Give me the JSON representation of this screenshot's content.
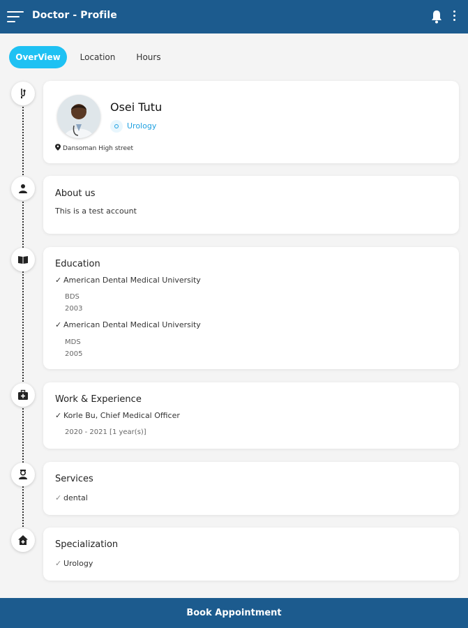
{
  "appbar": {
    "title": "Doctor - Profile",
    "menu_icon": "hamburger-menu-icon",
    "bell_icon": "bell-icon",
    "more_icon": "more-vertical-icon",
    "color": "#1c5b8e"
  },
  "tabs": [
    {
      "label": "OverView",
      "active": true
    },
    {
      "label": "Location",
      "active": false
    },
    {
      "label": "Hours",
      "active": false
    }
  ],
  "accent_color": "#1ec1f3",
  "profile": {
    "name": "Osei Tutu",
    "specialty": "Urology",
    "address": "Dansoman High street"
  },
  "about": {
    "title": "About us",
    "text": "This is a test account"
  },
  "education": {
    "title": "Education",
    "items": [
      {
        "school": "American Dental Medical University",
        "degree": "BDS",
        "year": "2003"
      },
      {
        "school": "American Dental Medical University",
        "degree": "MDS",
        "year": "2005"
      }
    ]
  },
  "work": {
    "title": "Work & Experience",
    "items": [
      {
        "role": "Korle Bu, Chief Medical Officer",
        "period": "2020 - 2021 [1 year(s)]"
      }
    ]
  },
  "services": {
    "title": "Services",
    "items": [
      "dental"
    ]
  },
  "specialization": {
    "title": "Specialization",
    "items": [
      "Urology"
    ]
  },
  "footer": {
    "button_label": "Book Appointment"
  }
}
